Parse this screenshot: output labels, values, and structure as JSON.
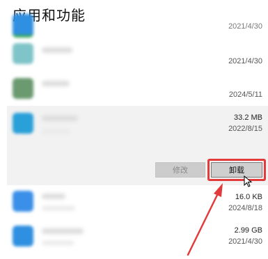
{
  "page": {
    "title": "应用和功能"
  },
  "apps": [
    {
      "size": "",
      "date": "2021/4/30"
    },
    {
      "size": "",
      "date": "2021/4/30"
    },
    {
      "size": "",
      "date": "2024/5/11"
    },
    {
      "size": "33.2 MB",
      "date": "2022/8/15"
    },
    {
      "size": "16.0 KB",
      "date": "2024/8/18"
    },
    {
      "size": "2.99 GB",
      "date": "2021/4/30"
    }
  ],
  "buttons": {
    "modify_label": "修改",
    "uninstall_label": "卸载"
  },
  "colors": {
    "highlight": "#e23b3b",
    "icon_green": "#3aa85a",
    "icon_blue": "#2f8fe0",
    "icon_teal": "#5fb0c8"
  }
}
